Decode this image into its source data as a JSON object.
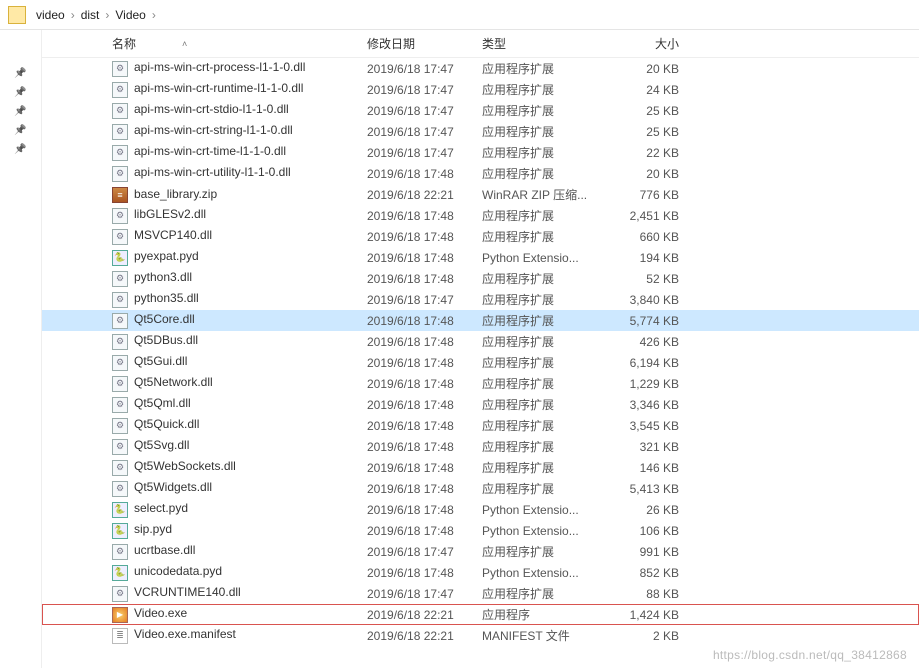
{
  "breadcrumb": {
    "segs": [
      "video",
      "dist",
      "Video"
    ],
    "sep": "›"
  },
  "columns": {
    "name": "名称",
    "date": "修改日期",
    "type": "类型",
    "size": "大小"
  },
  "pins_count": 5,
  "watermark": "https://blog.csdn.net/qq_38412868",
  "type_labels": {
    "ext": "应用程序扩展",
    "zip": "WinRAR ZIP 压缩...",
    "pyext": "Python Extensio...",
    "app": "应用程序",
    "manifest": "MANIFEST 文件"
  },
  "files": [
    {
      "icon": "dll",
      "name": "api-ms-win-crt-process-l1-1-0.dll",
      "date": "2019/6/18 17:47",
      "type": "ext",
      "size": "20 KB"
    },
    {
      "icon": "dll",
      "name": "api-ms-win-crt-runtime-l1-1-0.dll",
      "date": "2019/6/18 17:47",
      "type": "ext",
      "size": "24 KB"
    },
    {
      "icon": "dll",
      "name": "api-ms-win-crt-stdio-l1-1-0.dll",
      "date": "2019/6/18 17:47",
      "type": "ext",
      "size": "25 KB"
    },
    {
      "icon": "dll",
      "name": "api-ms-win-crt-string-l1-1-0.dll",
      "date": "2019/6/18 17:47",
      "type": "ext",
      "size": "25 KB"
    },
    {
      "icon": "dll",
      "name": "api-ms-win-crt-time-l1-1-0.dll",
      "date": "2019/6/18 17:47",
      "type": "ext",
      "size": "22 KB"
    },
    {
      "icon": "dll",
      "name": "api-ms-win-crt-utility-l1-1-0.dll",
      "date": "2019/6/18 17:48",
      "type": "ext",
      "size": "20 KB"
    },
    {
      "icon": "zip",
      "name": "base_library.zip",
      "date": "2019/6/18 22:21",
      "type": "zip",
      "size": "776 KB"
    },
    {
      "icon": "dll",
      "name": "libGLESv2.dll",
      "date": "2019/6/18 17:48",
      "type": "ext",
      "size": "2,451 KB"
    },
    {
      "icon": "dll",
      "name": "MSVCP140.dll",
      "date": "2019/6/18 17:48",
      "type": "ext",
      "size": "660 KB"
    },
    {
      "icon": "pyd",
      "name": "pyexpat.pyd",
      "date": "2019/6/18 17:48",
      "type": "pyext",
      "size": "194 KB"
    },
    {
      "icon": "dll",
      "name": "python3.dll",
      "date": "2019/6/18 17:48",
      "type": "ext",
      "size": "52 KB"
    },
    {
      "icon": "dll",
      "name": "python35.dll",
      "date": "2019/6/18 17:47",
      "type": "ext",
      "size": "3,840 KB"
    },
    {
      "icon": "dll",
      "name": "Qt5Core.dll",
      "date": "2019/6/18 17:48",
      "type": "ext",
      "size": "5,774 KB",
      "selected": true
    },
    {
      "icon": "dll",
      "name": "Qt5DBus.dll",
      "date": "2019/6/18 17:48",
      "type": "ext",
      "size": "426 KB"
    },
    {
      "icon": "dll",
      "name": "Qt5Gui.dll",
      "date": "2019/6/18 17:48",
      "type": "ext",
      "size": "6,194 KB"
    },
    {
      "icon": "dll",
      "name": "Qt5Network.dll",
      "date": "2019/6/18 17:48",
      "type": "ext",
      "size": "1,229 KB"
    },
    {
      "icon": "dll",
      "name": "Qt5Qml.dll",
      "date": "2019/6/18 17:48",
      "type": "ext",
      "size": "3,346 KB"
    },
    {
      "icon": "dll",
      "name": "Qt5Quick.dll",
      "date": "2019/6/18 17:48",
      "type": "ext",
      "size": "3,545 KB"
    },
    {
      "icon": "dll",
      "name": "Qt5Svg.dll",
      "date": "2019/6/18 17:48",
      "type": "ext",
      "size": "321 KB"
    },
    {
      "icon": "dll",
      "name": "Qt5WebSockets.dll",
      "date": "2019/6/18 17:48",
      "type": "ext",
      "size": "146 KB"
    },
    {
      "icon": "dll",
      "name": "Qt5Widgets.dll",
      "date": "2019/6/18 17:48",
      "type": "ext",
      "size": "5,413 KB"
    },
    {
      "icon": "pyd",
      "name": "select.pyd",
      "date": "2019/6/18 17:48",
      "type": "pyext",
      "size": "26 KB"
    },
    {
      "icon": "pyd",
      "name": "sip.pyd",
      "date": "2019/6/18 17:48",
      "type": "pyext",
      "size": "106 KB"
    },
    {
      "icon": "dll",
      "name": "ucrtbase.dll",
      "date": "2019/6/18 17:47",
      "type": "ext",
      "size": "991 KB"
    },
    {
      "icon": "pyd",
      "name": "unicodedata.pyd",
      "date": "2019/6/18 17:48",
      "type": "pyext",
      "size": "852 KB"
    },
    {
      "icon": "dll",
      "name": "VCRUNTIME140.dll",
      "date": "2019/6/18 17:47",
      "type": "ext",
      "size": "88 KB"
    },
    {
      "icon": "exe",
      "name": "Video.exe",
      "date": "2019/6/18 22:21",
      "type": "app",
      "size": "1,424 KB",
      "highlighted": true
    },
    {
      "icon": "txt",
      "name": "Video.exe.manifest",
      "date": "2019/6/18 22:21",
      "type": "manifest",
      "size": "2 KB"
    }
  ]
}
